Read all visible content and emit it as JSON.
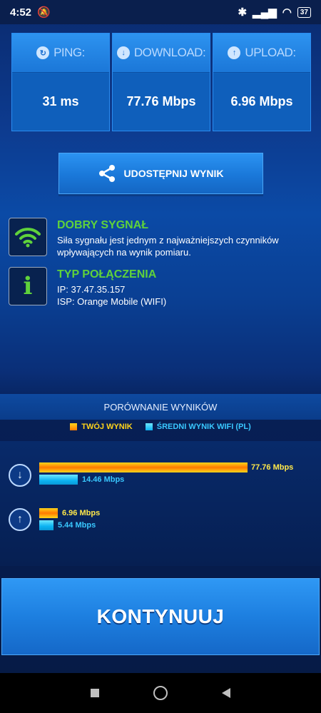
{
  "status": {
    "time": "4:52",
    "battery": "37"
  },
  "stats": [
    {
      "label": "PING:",
      "value": "31 ms",
      "icon": "ping-icon"
    },
    {
      "label": "DOWNLOAD:",
      "value": "77.76 Mbps",
      "icon": "download-icon"
    },
    {
      "label": "UPLOAD:",
      "value": "6.96 Mbps",
      "icon": "upload-icon"
    }
  ],
  "share": {
    "label": "UDOSTĘPNIJ WYNIK"
  },
  "signal": {
    "title": "DOBRY SYGNAŁ",
    "line1": "Siła sygnału jest jednym z najważniejszych czynników",
    "line2": "wpływających na wynik pomiaru."
  },
  "connection": {
    "title": "TYP POŁĄCZENIA",
    "ip": "IP: 37.47.35.157",
    "isp": "ISP: Orange Mobile (WIFI)"
  },
  "comparison": {
    "title": "PORÓWNANIE WYNIKÓW",
    "legend_yours": "TWÓJ WYNIK",
    "legend_avg": "ŚREDNI WYNIK WIFI (PL)",
    "download_yours": "77.76 Mbps",
    "download_avg": "14.46 Mbps",
    "upload_yours": "6.96 Mbps",
    "upload_avg": "5.44 Mbps"
  },
  "continue": {
    "label": "KONTYNUUJ"
  },
  "colors": {
    "accent_green": "#5fd23b",
    "yours": "#ffd41a",
    "avg": "#39c8ff"
  }
}
